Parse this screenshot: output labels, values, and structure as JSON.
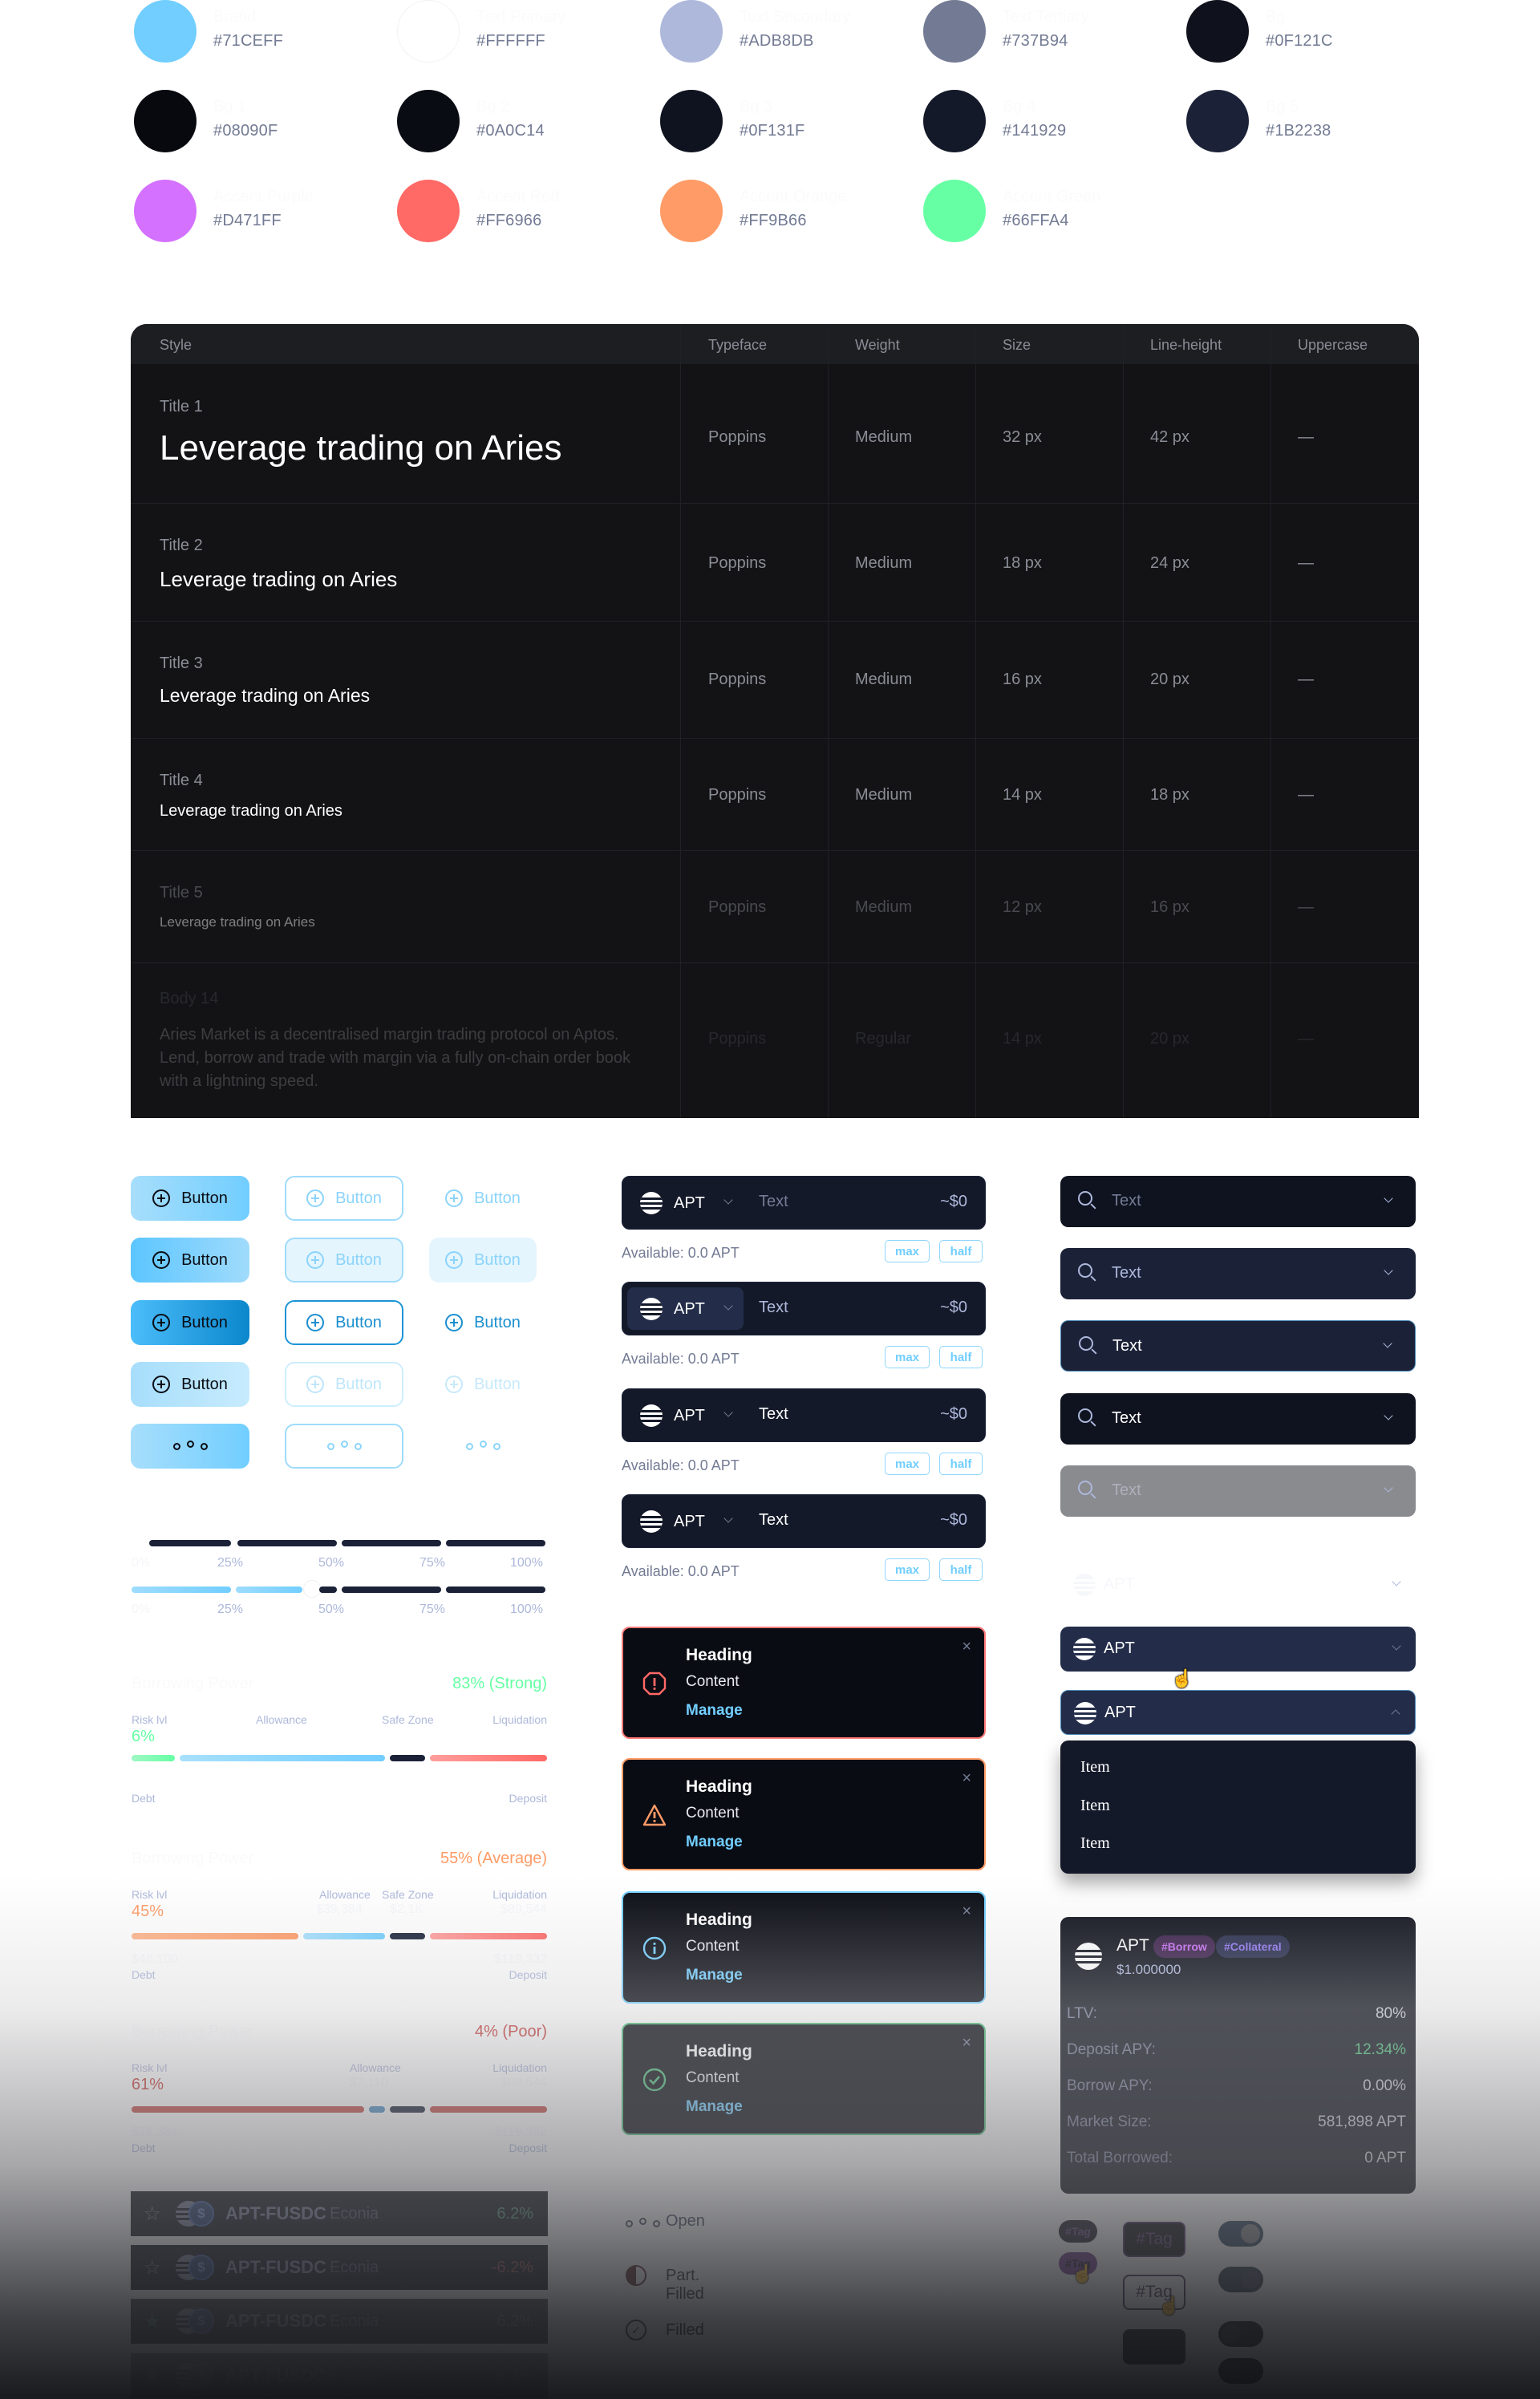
{
  "palette": [
    {
      "name": "Brand",
      "hex": "#71CEFF"
    },
    {
      "name": "Text Primary",
      "hex": "#FFFFFF"
    },
    {
      "name": "Text Secondary",
      "hex": "#ADB8DB"
    },
    {
      "name": "Text Tertiary",
      "hex": "#737B94"
    },
    {
      "name": "Bg",
      "hex": "#0F121C"
    },
    {
      "name": "Bg 1",
      "hex": "#08090F"
    },
    {
      "name": "Bg 2",
      "hex": "#0A0C14"
    },
    {
      "name": "Bg 3",
      "hex": "#0F131F"
    },
    {
      "name": "Bg 4",
      "hex": "#141929"
    },
    {
      "name": "Bg 5",
      "hex": "#1B2238"
    },
    {
      "name": "Accent Purple",
      "hex": "#D471FF"
    },
    {
      "name": "Accent Red",
      "hex": "#FF6966"
    },
    {
      "name": "Accent Orange",
      "hex": "#FF9B66"
    },
    {
      "name": "Accent Green",
      "hex": "#66FFA4"
    }
  ],
  "typography": {
    "headers": [
      "Style",
      "Typeface",
      "Weight",
      "Size",
      "Line-height",
      "Uppercase"
    ],
    "rows": [
      {
        "style": "Title 1",
        "sample": "Leverage trading on Aries",
        "typeface": "Poppins",
        "weight": "Medium",
        "size": "32 px",
        "line_height": "42 px",
        "uppercase": "—"
      },
      {
        "style": "Title 2",
        "sample": "Leverage trading on Aries",
        "typeface": "Poppins",
        "weight": "Medium",
        "size": "18 px",
        "line_height": "24 px",
        "uppercase": "—"
      },
      {
        "style": "Title 3",
        "sample": "Leverage trading on Aries",
        "typeface": "Poppins",
        "weight": "Medium",
        "size": "16 px",
        "line_height": "20 px",
        "uppercase": "—"
      },
      {
        "style": "Title 4",
        "sample": "Leverage trading on Aries",
        "typeface": "Poppins",
        "weight": "Medium",
        "size": "14 px",
        "line_height": "18 px",
        "uppercase": "—"
      },
      {
        "style": "Title 5",
        "sample": "Leverage trading on Aries",
        "typeface": "Poppins",
        "weight": "Medium",
        "size": "12 px",
        "line_height": "16 px",
        "uppercase": "—"
      },
      {
        "style": "Body 14",
        "sample": "Aries Market is a decentralised margin trading protocol on Aptos. Lend, borrow and trade with margin via a fully on-chain order book with a lightning speed.",
        "typeface": "Poppins",
        "weight": "Regular",
        "size": "14 px",
        "line_height": "20 px",
        "uppercase": "—"
      }
    ]
  },
  "buttons": {
    "label": "Button"
  },
  "sliders": {
    "ticks": [
      "0%",
      "25%",
      "50%",
      "75%",
      "100%"
    ],
    "slider1_value": 0,
    "slider2_value": 40
  },
  "risk_bars": [
    {
      "title": "Borrowing Power",
      "score": "83% (Strong)",
      "score_color": "#66FFA4",
      "risk_label": "Risk lvl",
      "risk_value": "6%",
      "risk_color": "#66FFA4",
      "labels": [
        "Allowance",
        "Safe Zone",
        "Liquidation"
      ],
      "values": [
        "",
        "",
        ""
      ],
      "debt_label": "Debt",
      "debt_value": "",
      "deposit_label": "Deposit",
      "deposit_value": ""
    },
    {
      "title": "Borrowing Power",
      "score": "55% (Average)",
      "score_color": "#FF9B66",
      "risk_label": "Risk lvl",
      "risk_value": "45%",
      "risk_color": "#FF9B66",
      "labels": [
        "Allowance",
        "Safe Zone",
        "Liquidation"
      ],
      "values": [
        "$39,384",
        "$2,1K",
        "$89,544"
      ],
      "debt_label": "Debt",
      "debt_value": "$48,100",
      "deposit_label": "Deposit",
      "deposit_value": "$119,332"
    },
    {
      "title": "Borrowing Power",
      "score": "4% (Poor)",
      "score_color": "#C9403D",
      "risk_label": "Risk lvl",
      "risk_value": "61%",
      "risk_color": "#C9403D",
      "labels": [
        "Allowance",
        "Liquidation"
      ],
      "values": [
        "$2,110",
        "$89,544"
      ],
      "debt_label": "Debt",
      "debt_value": "$76,384",
      "deposit_label": "Deposit",
      "deposit_value": "$119,332"
    }
  ],
  "pairs": [
    {
      "name": "APT-FUSDC",
      "exchange": "Econia",
      "change": "6.2%",
      "starred": false,
      "positive": true
    },
    {
      "name": "APT-FUSDC",
      "exchange": "Econia",
      "change": "-6.2%",
      "starred": false,
      "positive": false
    },
    {
      "name": "APT-FUSDC",
      "exchange": "Econia",
      "change": "6.2%",
      "starred": true,
      "positive": true
    },
    {
      "name": "APT-FUSDC",
      "exchange": "Econia",
      "change": "6.2%",
      "starred": true,
      "positive": true
    }
  ],
  "apt_inputs": [
    {
      "token": "APT",
      "text": "Text",
      "usd": "~$0",
      "available": "Available:  0.0 APT",
      "max": "max",
      "half": "half"
    },
    {
      "token": "APT",
      "text": "Text",
      "usd": "~$0",
      "available": "Available:  0.0 APT",
      "max": "max",
      "half": "half"
    },
    {
      "token": "APT",
      "text": "Text",
      "usd": "~$0",
      "available": "Available:  0.0 APT",
      "max": "max",
      "half": "half"
    },
    {
      "token": "APT",
      "text": "Text",
      "usd": "~$0",
      "available": "Available:  0.0 APT",
      "max": "max",
      "half": "half"
    }
  ],
  "notifications": [
    {
      "type": "error",
      "heading": "Heading",
      "content": "Content",
      "action": "Manage",
      "close": "×"
    },
    {
      "type": "warning",
      "heading": "Heading",
      "content": "Content",
      "action": "Manage",
      "close": "×"
    },
    {
      "type": "info",
      "heading": "Heading",
      "content": "Content",
      "action": "Manage",
      "close": "×"
    },
    {
      "type": "success",
      "heading": "Heading",
      "content": "Content",
      "action": "Manage",
      "close": "×"
    }
  ],
  "order_status": [
    {
      "label": "Open",
      "icon": "dots-icon"
    },
    {
      "label": "Part. Filled",
      "icon": "half-circle-icon"
    },
    {
      "label": "Filled",
      "icon": "check-circle-icon"
    }
  ],
  "search_dropdowns": [
    {
      "text": "Text",
      "state": "default"
    },
    {
      "text": "Text",
      "state": "hover"
    },
    {
      "text": "Text",
      "state": "focused"
    },
    {
      "text": "Text",
      "state": "filled"
    },
    {
      "text": "Text",
      "state": "disabled"
    }
  ],
  "token_dropdowns": [
    {
      "token": "APT",
      "state": "ghost"
    },
    {
      "token": "APT",
      "state": "hover"
    },
    {
      "token": "APT",
      "state": "open"
    }
  ],
  "token_menu": {
    "items": [
      "Item",
      "Item",
      "Item"
    ]
  },
  "asset_card": {
    "token": "APT",
    "price": "$1.000000",
    "tags": [
      "#Borrow",
      "#Collateral"
    ],
    "rows": [
      {
        "label": "LTV:",
        "value": "80%"
      },
      {
        "label": "Deposit APY:",
        "value": "12.34%"
      },
      {
        "label": "Borrow APY:",
        "value": "0.00%"
      },
      {
        "label": "Market Size:",
        "value": "581,898 APT"
      },
      {
        "label": "Total Borrowed:",
        "value": "0 APT"
      }
    ]
  },
  "tags": {
    "label": "#Tag"
  },
  "toggles": [
    {
      "on": true,
      "disabled": false
    },
    {
      "on": true,
      "disabled": true
    },
    {
      "on": false,
      "disabled": false
    },
    {
      "on": false,
      "disabled": true
    }
  ]
}
